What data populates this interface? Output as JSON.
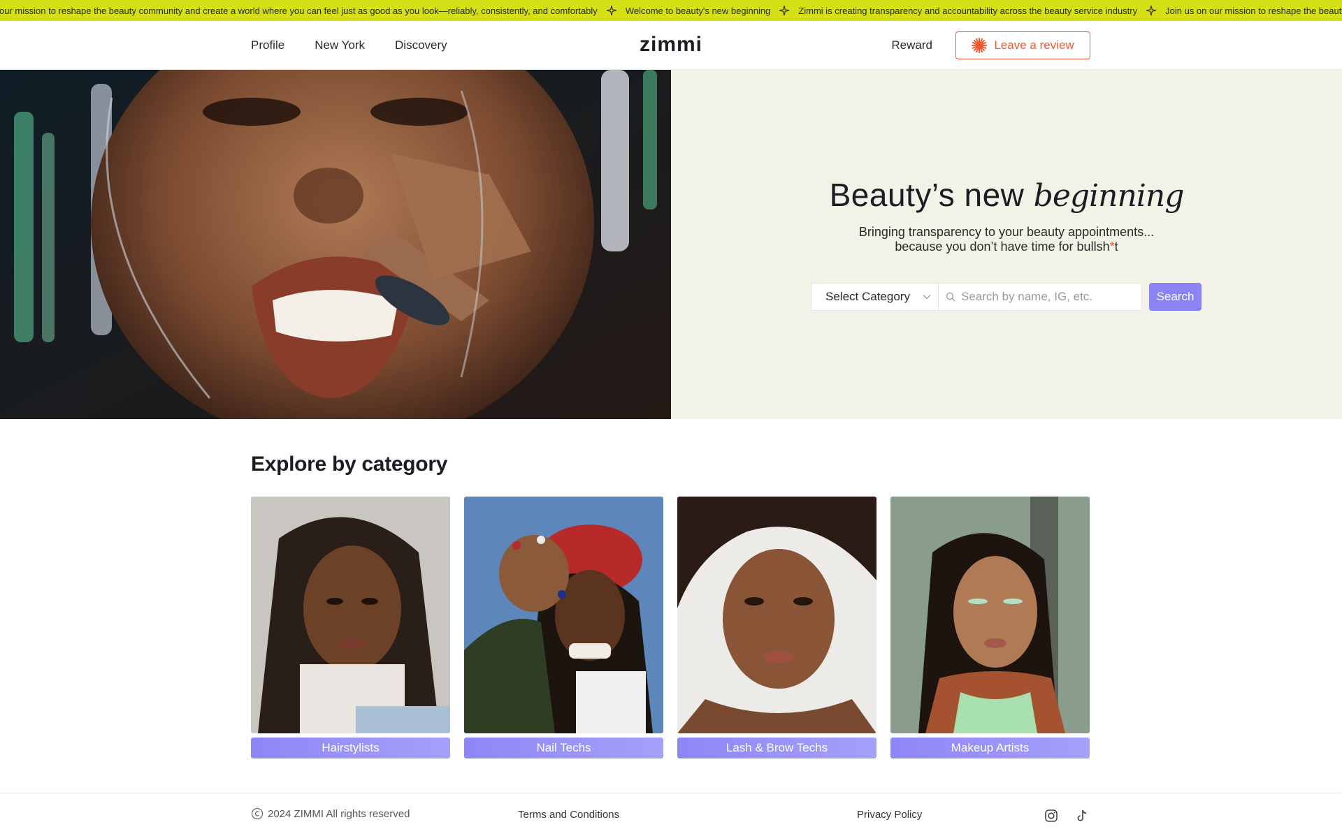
{
  "ticker": {
    "messages": [
      "our mission to reshape the beauty community and create a world where you can feel just as good as you look—reliably, consistently, and comfortably",
      "Welcome to beauty's new beginning",
      "Zimmi is creating transparency and accountability across the beauty service industry",
      "Join us on our mission to reshape the beauty community and create a world where you can feel just as good as you look—reliably, consistently, and comfortably"
    ],
    "colors": {
      "background": "#d4df16"
    }
  },
  "header": {
    "nav": [
      "Profile",
      "New York",
      "Discovery"
    ],
    "logo": "zimmi",
    "reward": "Reward",
    "review_button": "Leave a review",
    "colors": {
      "accent": "#f0582f"
    }
  },
  "hero": {
    "title_main": "Beauty’s new",
    "title_script": "beginning",
    "sub_line1": "Bringing transparency to your beauty appointments...",
    "sub_line2_pre": "because you don’t have time for bullsh",
    "sub_line2_ast": "*",
    "sub_line2_post": "t",
    "select_label": "Select Category",
    "search_placeholder": "Search by name, IG, etc.",
    "search_button": "Search",
    "colors": {
      "panel": "#f2f2e6",
      "button": "#8a83f3"
    }
  },
  "explore": {
    "title": "Explore by category",
    "categories": [
      {
        "label": "Hairstylists"
      },
      {
        "label": "Nail Techs"
      },
      {
        "label": "Lash & Brow Techs"
      },
      {
        "label": "Makeup Artists"
      }
    ]
  },
  "footer": {
    "copyright": "2024 ZIMMI All rights reserved",
    "terms": "Terms and Conditions",
    "privacy": "Privacy Policy",
    "social": [
      "instagram-icon",
      "tiktok-icon"
    ]
  }
}
